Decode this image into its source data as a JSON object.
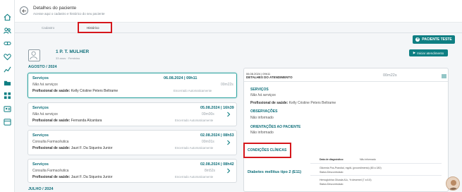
{
  "header": {
    "title": "Detalhes do paciente",
    "subtitle": "Acesse aqui o cadastro e histórico do seu paciente"
  },
  "tabs": [
    {
      "label": "Cadastro",
      "active": false
    },
    {
      "label": "Histórico",
      "active": true
    }
  ],
  "actions": {
    "novo_paciente": "PACIENTE TESTE",
    "iniciar": "Iniciar atendimento"
  },
  "patient": {
    "name": "1 P. T. MULHER",
    "meta": "33 anos · Feminino"
  },
  "months": [
    "AGOSTO / 2024",
    "JULHO / 2024"
  ],
  "cards": [
    {
      "service_label": "Serviços",
      "datetime": "06.08.2024 | 09h11",
      "description": "Não há serviços",
      "duration": "00m22s",
      "prof_label": "Profissional de saúde:",
      "professional": "Kelly Cristine Peters Beltrame",
      "status": "Encerrado Automaticamente"
    },
    {
      "service_label": "Serviços",
      "datetime": "05.08.2024 | 16h39",
      "description": "Não há serviços",
      "duration": "00m00s",
      "prof_label": "Profissional de saúde:",
      "professional": "Fernanda Alcantara",
      "status": "Encerrado Automaticamente"
    },
    {
      "service_label": "Serviços",
      "datetime": "02.08.2024 | 08h53",
      "description": "Consulta Farmacêutica",
      "duration": "00m01s",
      "prof_label": "Profissional de saúde:",
      "professional": "Jauri F. Da Siqueira Junior",
      "status": "Encerrado Automaticamente"
    },
    {
      "service_label": "Serviços",
      "datetime": "02.08.2024 | 08h42",
      "description": "Consulta Farmacêutica",
      "duration": "8m52s",
      "prof_label": "Profissional de saúde:",
      "professional": "Jauri F. Da Siqueira Junior",
      "status": "Encerrado Automaticamente"
    }
  ],
  "detail": {
    "date": "06.08.2024 | 09h11",
    "heading": "DETALHES DO ATENDIMENTO",
    "duration": "00m22s",
    "servicos_label": "SERVIÇOS",
    "servicos_value": "Não há serviços",
    "prof_label": "Profissional de saúde:",
    "professional": "Kelly Cristine Peters Beltrame",
    "obs_label": "OBSERVAÇÕES",
    "obs_value": "Não informado",
    "orient_label": "ORIENTAÇÕES AO PACIENTE",
    "orient_value": "Não informado",
    "cond_label": "CONDIÇÕES CLÍNICAS",
    "cond_name": "Diabetes mellitus tipo 2 (E11)",
    "diag_label": "Data de diagnóstico:",
    "diag_value": "Não informado",
    "exam1": "Glicemia Pós-Prandial, mg/dL (procedimento) (80 a 180)",
    "exam1_status": "Status:Descontrolado",
    "exam2": "Hemoglobina Glicada A1c, % desemel (7 a 6.5)",
    "exam2_status": "Status:Descontrolado"
  },
  "colors": {
    "primary": "#0f7f83",
    "highlight": "#d5171c"
  }
}
